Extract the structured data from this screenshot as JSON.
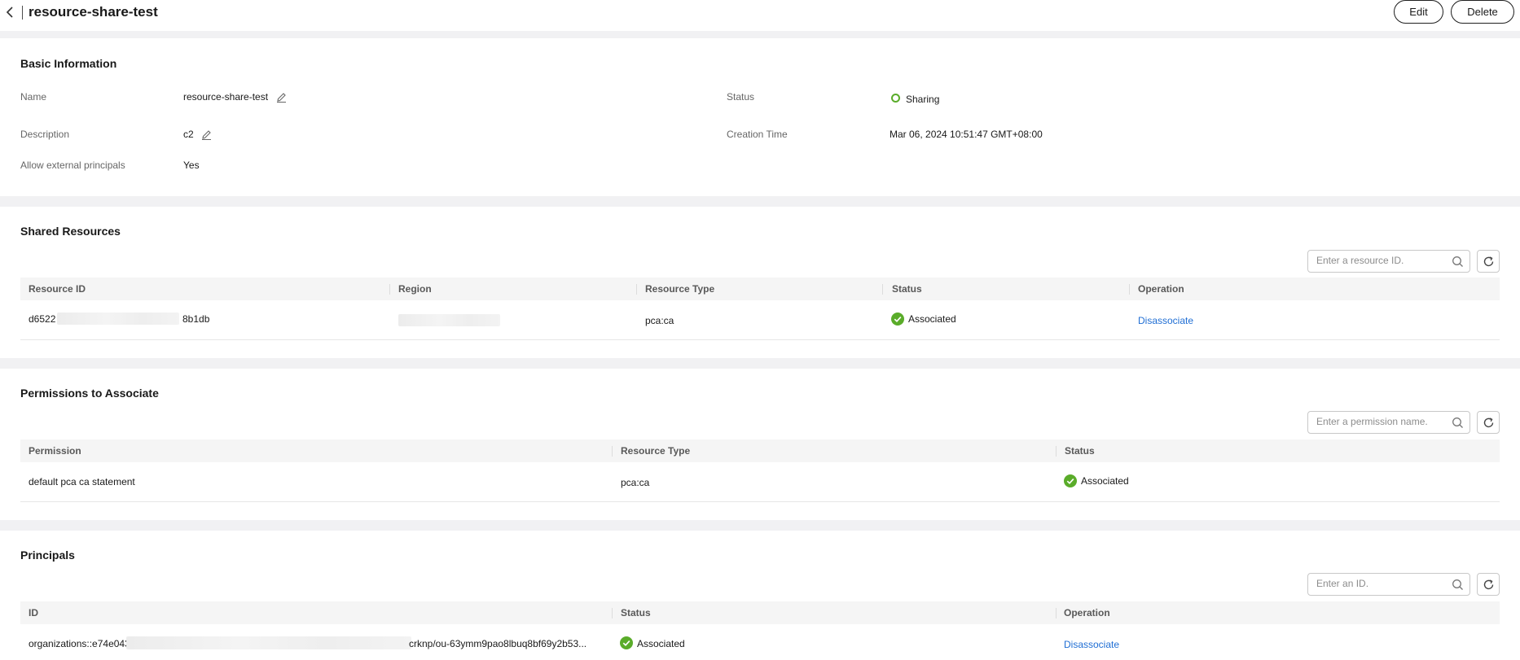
{
  "header": {
    "title": "resource-share-test",
    "edit_label": "Edit",
    "delete_label": "Delete"
  },
  "basic": {
    "section_title": "Basic Information",
    "name_label": "Name",
    "name_value": "resource-share-test",
    "description_label": "Description",
    "description_value": "c2",
    "external_label": "Allow external principals",
    "external_value": "Yes",
    "status_label": "Status",
    "status_value": "Sharing",
    "creation_label": "Creation Time",
    "creation_value": "Mar 06, 2024 10:51:47 GMT+08:00"
  },
  "shared_resources": {
    "section_title": "Shared Resources",
    "search_placeholder": "Enter a resource ID.",
    "columns": [
      "Resource ID",
      "Region",
      "Resource Type",
      "Status",
      "Operation"
    ],
    "rows": [
      {
        "resource_id_start": "d6522",
        "resource_id_end": "8b1db",
        "resource_type": "pca:ca",
        "status": "Associated",
        "operation": "Disassociate"
      }
    ]
  },
  "permissions": {
    "section_title": "Permissions to Associate",
    "search_placeholder": "Enter a permission name.",
    "columns": [
      "Permission",
      "Resource Type",
      "Status"
    ],
    "rows": [
      {
        "permission": "default pca ca statement",
        "resource_type": "pca:ca",
        "status": "Associated"
      }
    ]
  },
  "principals": {
    "section_title": "Principals",
    "search_placeholder": "Enter an ID.",
    "columns": [
      "ID",
      "Status",
      "Operation"
    ],
    "rows": [
      {
        "id_start": "organizations::e74e043",
        "id_end": "crknp/ou-63ymm9pao8lbuq8bf69y2b53...",
        "status": "Associated",
        "operation": "Disassociate"
      }
    ]
  },
  "colors": {
    "link": "#1f6ed4",
    "success": "#5aac2a"
  },
  "icons": {
    "back": "chevron-left-icon",
    "edit": "pencil-icon",
    "search": "search-icon",
    "refresh": "refresh-icon",
    "status_ok": "check-circle-icon",
    "sharing": "ring-dot-icon"
  }
}
